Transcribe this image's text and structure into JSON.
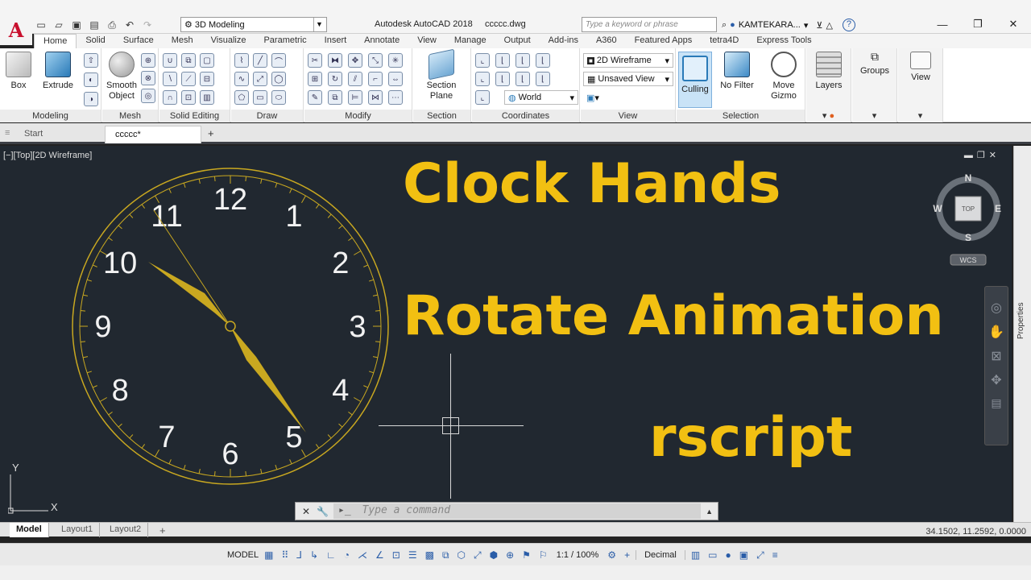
{
  "app": {
    "title": "Autodesk AutoCAD 2018",
    "document": "ccccc.dwg",
    "workspace": "3D Modeling",
    "search_placeholder": "Type a keyword or phrase",
    "user": "KAMTEKARA..."
  },
  "ribbon_tabs": [
    "Home",
    "Solid",
    "Surface",
    "Mesh",
    "Visualize",
    "Parametric",
    "Insert",
    "Annotate",
    "View",
    "Manage",
    "Output",
    "Add-ins",
    "A360",
    "Featured Apps",
    "tetra4D",
    "Express Tools"
  ],
  "ribbon": {
    "modeling": {
      "label": "Modeling",
      "box": "Box",
      "extrude": "Extrude"
    },
    "mesh": {
      "label": "Mesh",
      "smooth_line1": "Smooth",
      "smooth_line2": "Object"
    },
    "solid_editing": {
      "label": "Solid Editing"
    },
    "draw": {
      "label": "Draw"
    },
    "modify": {
      "label": "Modify"
    },
    "section": {
      "label": "Section",
      "btn_line1": "Section",
      "btn_line2": "Plane"
    },
    "coordinates": {
      "label": "Coordinates",
      "ucs": "World"
    },
    "view": {
      "label": "View",
      "visual_style": "2D Wireframe",
      "named_view": "Unsaved View"
    },
    "selection": {
      "label": "Selection",
      "culling": "Culling",
      "nofilter": "No Filter",
      "gizmo_line1": "Move",
      "gizmo_line2": "Gizmo"
    },
    "layers": "Layers",
    "groups": "Groups",
    "view_btn": "View"
  },
  "file_tabs": {
    "start": "Start",
    "doc": "ccccc*"
  },
  "viewport": {
    "label": "[−][Top][2D Wireframe]",
    "title_line1": "Clock Hands",
    "title_line2": "Rotate Animation",
    "title_line3": "rscript",
    "clock_numbers": [
      "12",
      "1",
      "2",
      "3",
      "4",
      "5",
      "6",
      "7",
      "8",
      "9",
      "10",
      "11"
    ],
    "viewcube": {
      "top": "TOP",
      "n": "N",
      "s": "S",
      "e": "E",
      "w": "W",
      "wcs": "WCS"
    },
    "ucs_x": "X",
    "ucs_y": "Y",
    "command_placeholder": "Type a command"
  },
  "properties_label": "Properties",
  "layout_tabs": [
    "Model",
    "Layout1",
    "Layout2"
  ],
  "coordinates_readout": "34.1502, 11.2592, 0.0000",
  "status": {
    "model": "MODEL",
    "scale": "1:1 / 100%",
    "units": "Decimal"
  },
  "colors": {
    "accent_yellow": "#f2c012",
    "viewport_bg": "#212830",
    "brand_red": "#c8102e"
  }
}
